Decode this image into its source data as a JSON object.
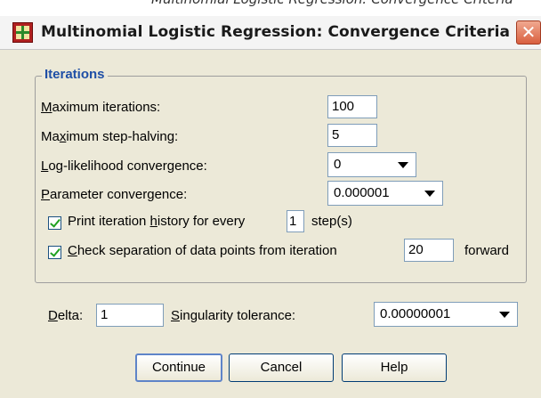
{
  "background_window": {
    "cut_text": "Multinomial Logistic Regression: Convergence Criteria"
  },
  "window": {
    "title": "Multinomial Logistic Regression: Convergence Criteria",
    "app_icon": "spss-dialog-icon",
    "close_icon": "close-x-icon",
    "close_glyph": "✕"
  },
  "iterations": {
    "legend": "Iterations",
    "max_iterations": {
      "prefix": "M",
      "rest": "aximum iterations:",
      "value": "100"
    },
    "max_step_halving": {
      "pre": "Ma",
      "mnemonic": "x",
      "rest": "imum step-halving:",
      "value": "5"
    },
    "log_likelihood": {
      "mnemonic": "L",
      "rest": "og-likelihood convergence:",
      "value": "0"
    },
    "parameter": {
      "mnemonic": "P",
      "rest": "arameter convergence:",
      "value": "0.000001"
    },
    "print_history": {
      "pre": "Print iteration ",
      "mnemonic": "h",
      "mid": "istory for every",
      "value": "1",
      "post": "step(s)",
      "checked": true
    },
    "check_separation": {
      "mnemonic": "C",
      "rest": "heck separation of data points from iteration",
      "value": "20",
      "post": "forward",
      "checked": true
    }
  },
  "delta": {
    "mnemonic": "D",
    "rest": "elta:",
    "value": "1"
  },
  "singularity": {
    "mnemonic": "S",
    "rest": "ingularity tolerance:",
    "value": "0.00000001"
  },
  "buttons": {
    "continue": "Continue",
    "cancel": "Cancel",
    "help": "Help"
  }
}
